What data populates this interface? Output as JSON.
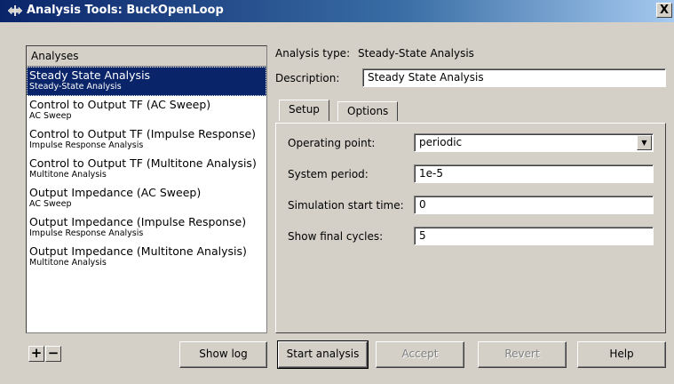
{
  "window": {
    "title": "Analysis Tools: BuckOpenLoop",
    "close_label": "X"
  },
  "analyses": {
    "header": "Analyses",
    "items": [
      {
        "name": "Steady State Analysis",
        "type": "Steady-State Analysis",
        "selected": true
      },
      {
        "name": "Control to Output TF (AC Sweep)",
        "type": "AC Sweep"
      },
      {
        "name": "Control to Output TF (Impulse Response)",
        "type": "Impulse Response Analysis"
      },
      {
        "name": "Control to Output TF (Multitone Analysis)",
        "type": "Multitone Analysis"
      },
      {
        "name": "Output Impedance (AC Sweep)",
        "type": "AC Sweep"
      },
      {
        "name": "Output Impedance (Impulse Response)",
        "type": "Impulse Response Analysis"
      },
      {
        "name": "Output Impedance (Multitone Analysis)",
        "type": "Multitone Analysis"
      }
    ],
    "add_label": "+",
    "remove_label": "−"
  },
  "details": {
    "analysis_type_label": "Analysis type:",
    "analysis_type_value": "Steady-State Analysis",
    "description_label": "Description:",
    "description_value": "Steady State Analysis",
    "tabs": [
      "Setup",
      "Options"
    ],
    "setup": {
      "operating_point_label": "Operating point:",
      "operating_point_value": "periodic",
      "system_period_label": "System period:",
      "system_period_value": "1e-5",
      "sim_start_label": "Simulation start time:",
      "sim_start_value": "0",
      "final_cycles_label": "Show final cycles:",
      "final_cycles_value": "5"
    }
  },
  "buttons": {
    "show_log": "Show log",
    "start_analysis": "Start analysis",
    "accept": "Accept",
    "revert": "Revert",
    "help": "Help"
  },
  "colors": {
    "title_bar": "#0a246a",
    "selection": "#0a246a",
    "window_bg": "#d4d0c8"
  }
}
